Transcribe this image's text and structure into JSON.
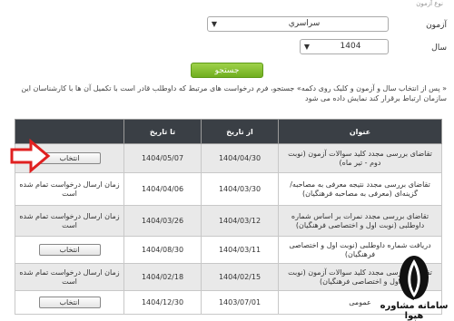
{
  "form": {
    "top_clip_text": "نوع آزمون",
    "exam_label": "آزمون",
    "exam_value": "سراسري",
    "year_label": "سال",
    "year_value": "1404",
    "search_label": "جستجو"
  },
  "help_text": "« پس از انتخاب سال و آزمون و کلیک روی دکمه» جستجو، فرم درخواست های مرتبط که داوطلب قادر است با تکمیل آن ها با کارشناسان این سازمان ارتباط برقرار کند نمایش داده می شود",
  "table": {
    "headers": {
      "title": "عنوان",
      "from": "از تاریخ",
      "to": "تا تاریخ",
      "action": ""
    },
    "select_label": "انتخاب",
    "rows": [
      {
        "title": "تقاضای بررسی مجدد کلید سوالات آزمون (نوبت دوم - تیر ماه)",
        "from": "1404/04/30",
        "to": "1404/05/07",
        "action": "انتخاب"
      },
      {
        "title": "تقاضای بررسی مجدد نتیجه معرفی به مصاحبه/گزینه‌ای (معرفی به مصاحبه فرهنگیان)",
        "from": "1404/03/30",
        "to": "1404/04/06",
        "action": "زمان ارسال درخواست تمام شده است"
      },
      {
        "title": "تقاضای بررسی مجدد نمرات بر اساس شماره داوطلبی (نوبت اول و اختصاصی فرهنگیان)",
        "from": "1404/03/12",
        "to": "1404/03/26",
        "action": "زمان ارسال درخواست تمام شده است"
      },
      {
        "title": "دریافت شماره داوطلبی (نوبت اول و اختصاصی فرهنگیان)",
        "from": "1404/03/11",
        "to": "1404/08/30",
        "action": "انتخاب"
      },
      {
        "title": "تقاضای بررسی مجدد کلید سوالات آزمون (نوبت اول و اختصاصی فرهنگیان)",
        "from": "1404/02/15",
        "to": "1404/02/18",
        "action": "زمان ارسال درخواست تمام شده است"
      },
      {
        "title": "عمومی",
        "from": "1403/07/01",
        "to": "1404/12/30",
        "action": "انتخاب"
      }
    ]
  },
  "watermark": {
    "text": "سامانه مشاوره هپوا"
  },
  "colors": {
    "accent": "#7ab82c",
    "header": "#3a3f45",
    "arrow": "#e02020"
  }
}
